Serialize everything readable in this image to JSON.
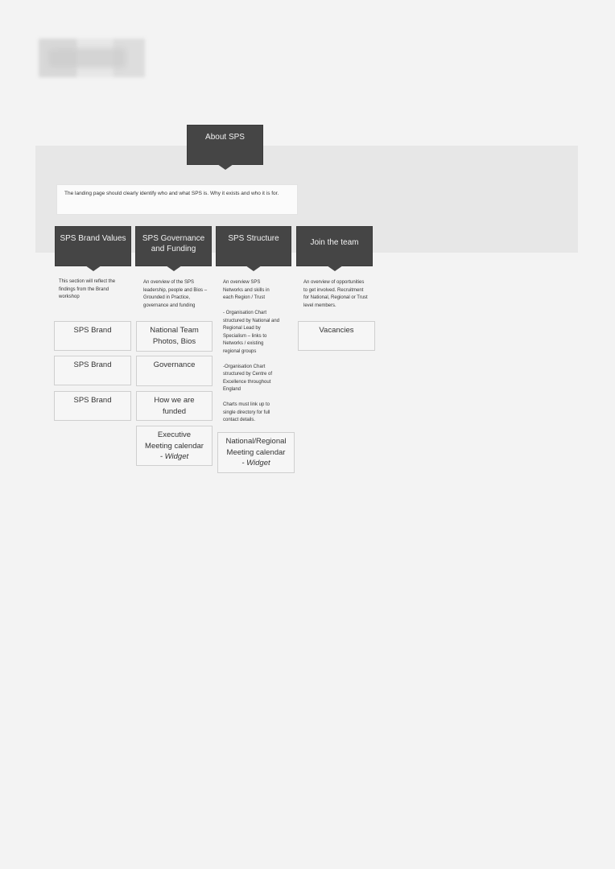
{
  "top": {
    "title": "About SPS"
  },
  "intro_text": "The landing page should clearly identify who and what SPS is. Why it exists and who it is for.",
  "columns": [
    {
      "header": "SPS Brand Values",
      "description": [
        "This section will reflect the findings from the Brand workshop"
      ],
      "boxes": [
        {
          "lines": [
            "SPS Brand"
          ]
        },
        {
          "lines": [
            "SPS Brand"
          ]
        },
        {
          "lines": [
            "SPS Brand"
          ]
        }
      ]
    },
    {
      "header": "SPS Governance and Funding",
      "description": [
        "An overview of the SPS leadership, people and Bios – Grounded in Practice, governance and funding"
      ],
      "boxes": [
        {
          "lines": [
            "National Team",
            "Photos, Bios"
          ]
        },
        {
          "lines": [
            "Governance"
          ]
        },
        {
          "lines": [
            "How we are",
            "funded"
          ]
        },
        {
          "lines": [
            "Executive",
            "Meeting calendar"
          ],
          "italic": "- Widget"
        }
      ]
    },
    {
      "header": "SPS Structure",
      "description": [
        "An overview SPS Networks and skills in each Region / Trust",
        "- Organisation Chart structured by National and Regional Lead by Specialism – links to Networks / existing regional groups",
        "-Organisation Chart structured by Centre of Excellence throughout England",
        "Charts must link up to single directory for full contact details."
      ],
      "boxes": [
        {
          "lines": [
            "National/Regional",
            "Meeting calendar"
          ],
          "italic": "- Widget"
        }
      ]
    },
    {
      "header": "Join the team",
      "description": [
        "An overview of opportunities to get involved. Recruitment for National, Regional or Trust level members."
      ],
      "boxes": [
        {
          "lines": [
            "Vacancies"
          ]
        }
      ]
    }
  ]
}
